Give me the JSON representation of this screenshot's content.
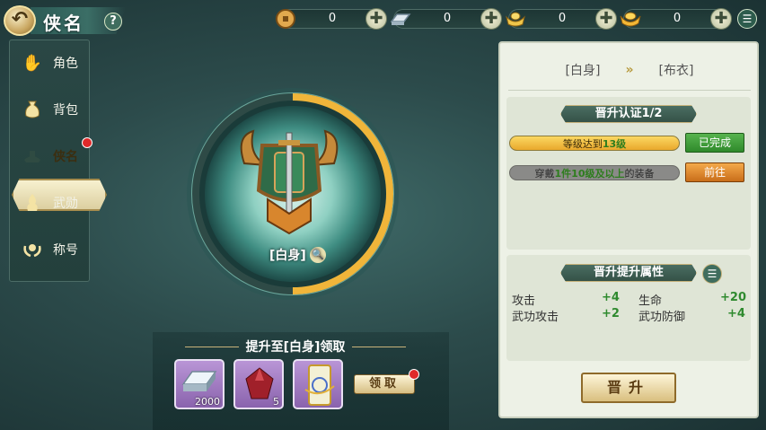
{
  "header": {
    "title": "侠名",
    "help": "?"
  },
  "currencies": [
    {
      "name": "copper-coin-icon",
      "value": "0",
      "plus": "✚"
    },
    {
      "name": "silver-ingot-icon",
      "value": "0",
      "plus": "✚"
    },
    {
      "name": "gold-ingot-icon",
      "value": "0",
      "plus": "✚"
    },
    {
      "name": "yuanbao-icon",
      "value": "0",
      "plus": "✚"
    }
  ],
  "sidebar": {
    "items": [
      {
        "label": "角色",
        "icon": "hand-icon"
      },
      {
        "label": "背包",
        "icon": "bag-icon"
      },
      {
        "label": "侠名",
        "icon": "hat-icon"
      },
      {
        "label": "武勋",
        "icon": "flame-icon"
      },
      {
        "label": "称号",
        "icon": "laurel-icon"
      }
    ]
  },
  "emblem": {
    "rank_label": "[白身]",
    "progress": 0.5
  },
  "reward": {
    "title": "提升至[白身]领取",
    "items": [
      {
        "count": "2000",
        "icon": "silver-ingot-icon"
      },
      {
        "count": "5",
        "icon": "red-gem-icon"
      },
      {
        "count": "",
        "icon": "scroll-card-icon"
      }
    ],
    "claim_label": "领取"
  },
  "panel": {
    "from_rank": "[白身]",
    "arrow": "»",
    "to_rank": "[布衣]",
    "cert": {
      "title": "晋升认证1/2",
      "req1": {
        "pre": "等级达到",
        "hl": "13级",
        "btn": "已完成",
        "progress": 1
      },
      "req2": {
        "pre": "穿戴",
        "hl": "1件10级及以上",
        "post": "的装备",
        "btn": "前往",
        "progress": 0
      }
    },
    "attrs": {
      "title": "晋升提升属性",
      "rows": [
        {
          "name": "攻击",
          "val": "+4",
          "name2": "生命",
          "val2": "+20"
        },
        {
          "name": "武功攻击",
          "val": "+2",
          "name2": "武功防御",
          "val2": "+4"
        }
      ]
    },
    "upgrade_label": "晋升"
  },
  "colors": {
    "accent_gold": "#f0b53a",
    "green_done": "#3f9d3a",
    "orange_go": "#d8872a"
  }
}
